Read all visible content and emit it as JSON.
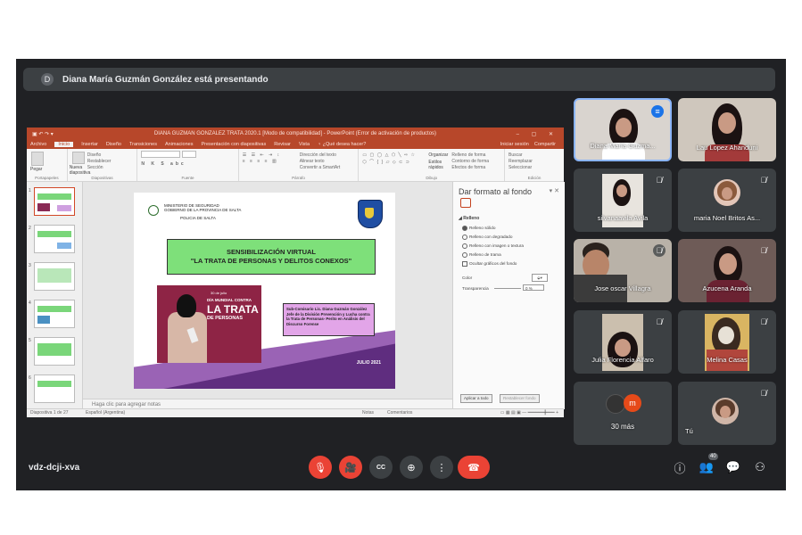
{
  "banner": {
    "initial": "D",
    "text": "Diana María Guzmán González está presentando"
  },
  "ppt": {
    "title": "DIANA GUZMAN GONZALEZ TRATA 2020.1 [Modo de compatibilidad] - PowerPoint (Error de activación de productos)",
    "window_controls": "–  ▢  ✕",
    "tabs": [
      "Archivo",
      "Inicio",
      "Insertar",
      "Diseño",
      "Transiciones",
      "Animaciones",
      "Presentación con diapositivas",
      "Revisar",
      "Vista",
      "♀ ¿Qué desea hacer?"
    ],
    "tabs_right": [
      "Iniciar sesión",
      "Compartir"
    ],
    "ribbon_groups": [
      "Portapapeles",
      "Diapositivas",
      "Fuente",
      "Párrafo",
      "Dibujo",
      "Edición"
    ],
    "ribbon_items": {
      "paste": "Pegar",
      "new_slide": "Nueva diapositiva",
      "layout": "Diseño",
      "reset": "Restablecer",
      "section": "Sección",
      "text_direction": "Dirección del texto",
      "align_text": "Alinear texto",
      "smartart": "Convertir a SmartArt",
      "organize": "Organizar",
      "quick_styles": "Estilos rápidos",
      "fill": "Relleno de forma",
      "outline": "Contorno de forma",
      "effects": "Efectos de forma",
      "search": "Buscar",
      "replace": "Reemplazar",
      "select": "Seleccionar"
    },
    "thumbnails": [
      "1",
      "2",
      "3",
      "4",
      "5",
      "6"
    ],
    "notes_placeholder": "Haga clic para agregar notas",
    "status": {
      "slide_count": "Diapositiva 1 de 27",
      "language": "Español (Argentina)",
      "notes": "Notas",
      "comments": "Comentarios",
      "zoom_controls": "▭ ▦ ▤ ▣ — ━━━━━━╋━━━ +"
    }
  },
  "slide": {
    "ministry_line1": "MINISTERIO DE SEGURIDAD",
    "ministry_line2": "GOBIERNO DE LA PROVINCIA DE SALTA",
    "police": "POLICIA DE SALTA",
    "title_line1": "SENSIBILIZACIÓN VIRTUAL",
    "title_line2": "\"LA TRATA DE PERSONAS Y DELITOS CONEXOS\"",
    "poster_date": "30 de julio",
    "poster_line1": "DÍA MUNDIAL CONTRA",
    "poster_line2": "LA TRATA",
    "poster_line3": "DE PERSONAS",
    "presenter_text": "Sub-Comisario Lic. Diana Guzmán González Jefe de la División Prevención y Lucha contra la Trata de Personas- Perito en Análisis del Discurso Forense",
    "date": "JULIO 2021"
  },
  "format_panel": {
    "title": "Dar formato al fondo",
    "close": "▾ ✕",
    "section": "◢ Relleno",
    "options": [
      "Relleno sólido",
      "Relleno con degradado",
      "Relleno con imagen o textura",
      "Relleno de trama",
      "Ocultar gráficos del fondo"
    ],
    "color_label": "Color",
    "transparency_label": "Transparencia",
    "transparency_value": "0 %",
    "apply_all": "Aplicar a todo",
    "reset_bg": "Restablecer fondo"
  },
  "participants": [
    {
      "name": "Diana María Guzma...",
      "state": "talking"
    },
    {
      "name": "Lau Lopez Ahanduni",
      "state": "unmuted"
    },
    {
      "name": "silvanaavila Avila",
      "state": "muted"
    },
    {
      "name": "maria Noel Britos As...",
      "state": "muted"
    },
    {
      "name": "Jose oscar Villagra",
      "state": "muted"
    },
    {
      "name": "Azucena Aranda",
      "state": "muted"
    },
    {
      "name": "Julia Florencia Alfaro",
      "state": "muted"
    },
    {
      "name": "Melina Casas",
      "state": "muted"
    },
    {
      "name": "30 más",
      "state": "group"
    },
    {
      "name": "Tú",
      "state": "muted"
    }
  ],
  "more_avatar_initial": "m",
  "meeting_code": "vdz-dcji-xva",
  "controls": {
    "mic_icon": "🎙",
    "cam_icon": "🎥",
    "cc_label": "CC",
    "present_icon": "⊕",
    "more_icon": "⋮",
    "hangup_icon": "☎"
  },
  "right_icons": {
    "info": "ⓘ",
    "people": "👥",
    "people_count": "40",
    "chat": "💬",
    "activities": "⚇"
  },
  "colors": {
    "meet_bg": "#202124",
    "tile_bg": "#3c4043",
    "ppt_accent": "#b7472a",
    "talking_blue": "#1a73e8",
    "red": "#ea4335"
  }
}
